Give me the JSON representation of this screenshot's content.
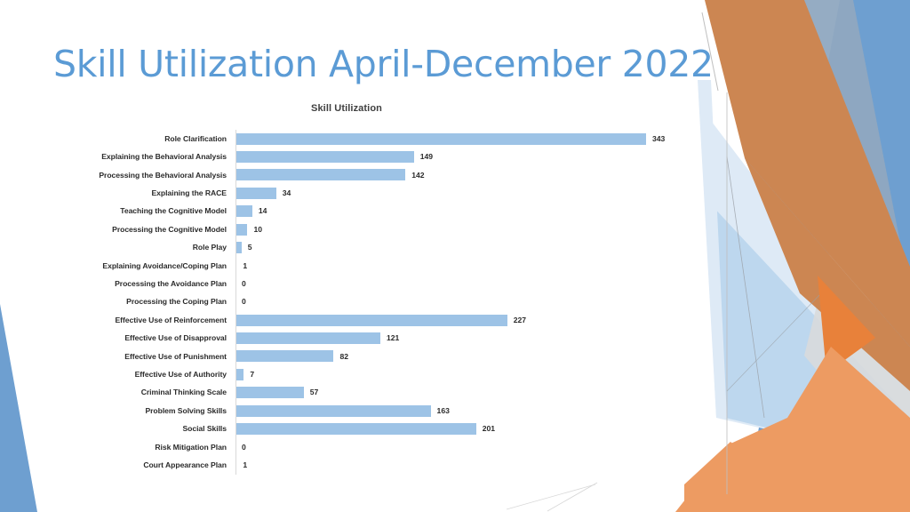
{
  "slide": {
    "title": "Skill Utilization April-December 2022",
    "title_color": "#5B9BD5",
    "background_color": "#FFFFFF"
  },
  "theme_shapes": {
    "accent_orange_dark": "#CC8652",
    "accent_orange_light": "#ED9B62",
    "accent_orange_bright": "#E8813A",
    "accent_blue": "#6E9FD0",
    "accent_blue_light": "#BDD7EE",
    "accent_blue_pale": "#DEEAF6",
    "accent_gray_blue": "#8FA8C0",
    "accent_gray": "#C9CCCE",
    "hairline": "#BFBFBF"
  },
  "chart_data": {
    "type": "bar",
    "orientation": "horizontal",
    "title": "Skill Utilization",
    "xlabel": "",
    "ylabel": "",
    "grid": false,
    "legend": false,
    "axis_max": 343,
    "bar_color": "#9DC3E6",
    "data_labels": true,
    "categories": [
      "Role Clarification",
      "Explaining the Behavioral Analysis",
      "Processing the Behavioral Analysis",
      "Explaining the RACE",
      "Teaching the Cognitive Model",
      "Processing the Cognitive Model",
      "Role Play",
      "Explaining Avoidance/Coping Plan",
      "Processing the Avoidance Plan",
      "Processing the Coping Plan",
      "Effective Use of Reinforcement",
      "Effective Use of Disapproval",
      "Effective Use of Punishment",
      "Effective Use of Authority",
      "Criminal Thinking Scale",
      "Problem Solving Skills",
      "Social Skills",
      "Risk Mitigation Plan",
      "Court Appearance Plan"
    ],
    "values": [
      343,
      149,
      142,
      34,
      14,
      10,
      5,
      1,
      0,
      0,
      227,
      121,
      82,
      7,
      57,
      163,
      201,
      0,
      1
    ]
  }
}
